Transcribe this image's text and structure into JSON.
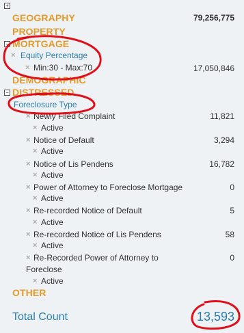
{
  "tree": {
    "expand_toggle": "+",
    "collapse_toggle": "−",
    "remove_glyph": "×",
    "categories": {
      "geography": {
        "label": "GEOGRAPHY",
        "count": "79,256,775"
      },
      "property": {
        "label": "PROPERTY"
      },
      "mortgage": {
        "label": "MORTGAGE",
        "field": "Equity Percentage",
        "filter_value": "Min:30 - Max:70",
        "filter_count": "17,050,846"
      },
      "demographic": {
        "label": "DEMOGRAPHIC"
      },
      "distressed": {
        "label": "DISTRESSED",
        "field": "Foreclosure Type",
        "active_label": "Active",
        "items": [
          {
            "label": "Newly Filed Complaint",
            "count": "11,821"
          },
          {
            "label": "Notice of Default",
            "count": "3,294"
          },
          {
            "label": "Notice of Lis Pendens",
            "count": "16,782"
          },
          {
            "label": "Power of Attorney to Foreclose Mortgage",
            "count": "0"
          },
          {
            "label": "Re-recorded Notice of Default",
            "count": "5"
          },
          {
            "label": "Re-recorded Notice of Lis Pendens",
            "count": "58"
          },
          {
            "label_line1": "Re-Recorded Power of Attorney to",
            "label_line2": "Foreclose",
            "count": "0"
          }
        ]
      },
      "other": {
        "label": "OTHER"
      }
    }
  },
  "footer": {
    "total_label": "Total Count",
    "total_value": "13,593"
  },
  "colors": {
    "category": "#e39a2b",
    "link": "#2a7db0",
    "annotation": "#e0101a",
    "background": "#eef2f5"
  }
}
